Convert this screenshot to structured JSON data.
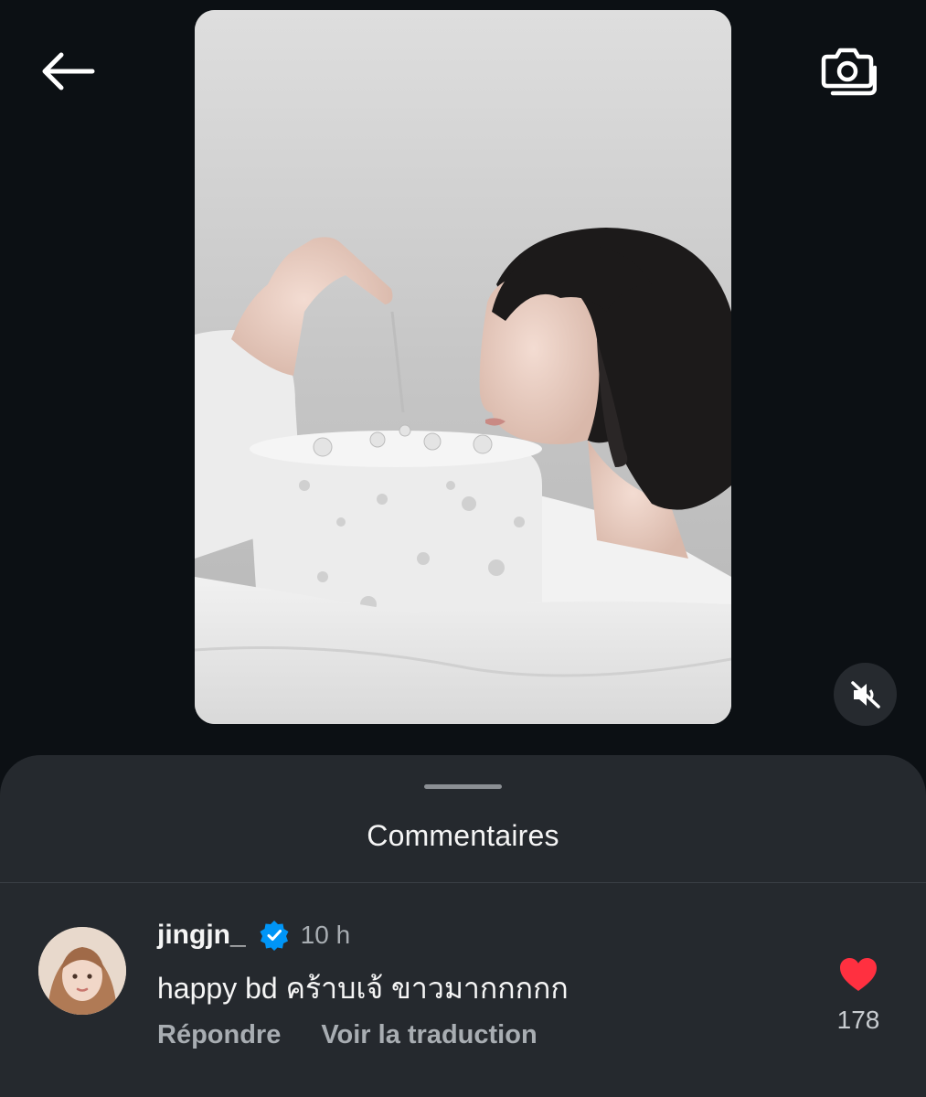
{
  "header": {
    "back_icon": "arrow-left-icon",
    "camera_icon": "camera-icon"
  },
  "media": {
    "description_icon": "photo",
    "mute_icon": "speaker-muted-icon"
  },
  "comments_sheet": {
    "title": "Commentaires",
    "comments": [
      {
        "username": "jingjn_",
        "verified": true,
        "time": "10 h",
        "text": "happy bd คร้าบเจ้ ขาวมากกกกก",
        "reply_label": "Répondre",
        "translate_label": "Voir la traduction",
        "likes": "178",
        "liked": true
      }
    ]
  },
  "colors": {
    "background": "#0c1014",
    "sheet": "#25292e",
    "heart": "#ff3040",
    "verified": "#0095f6",
    "muted_text": "#a8adb2"
  }
}
